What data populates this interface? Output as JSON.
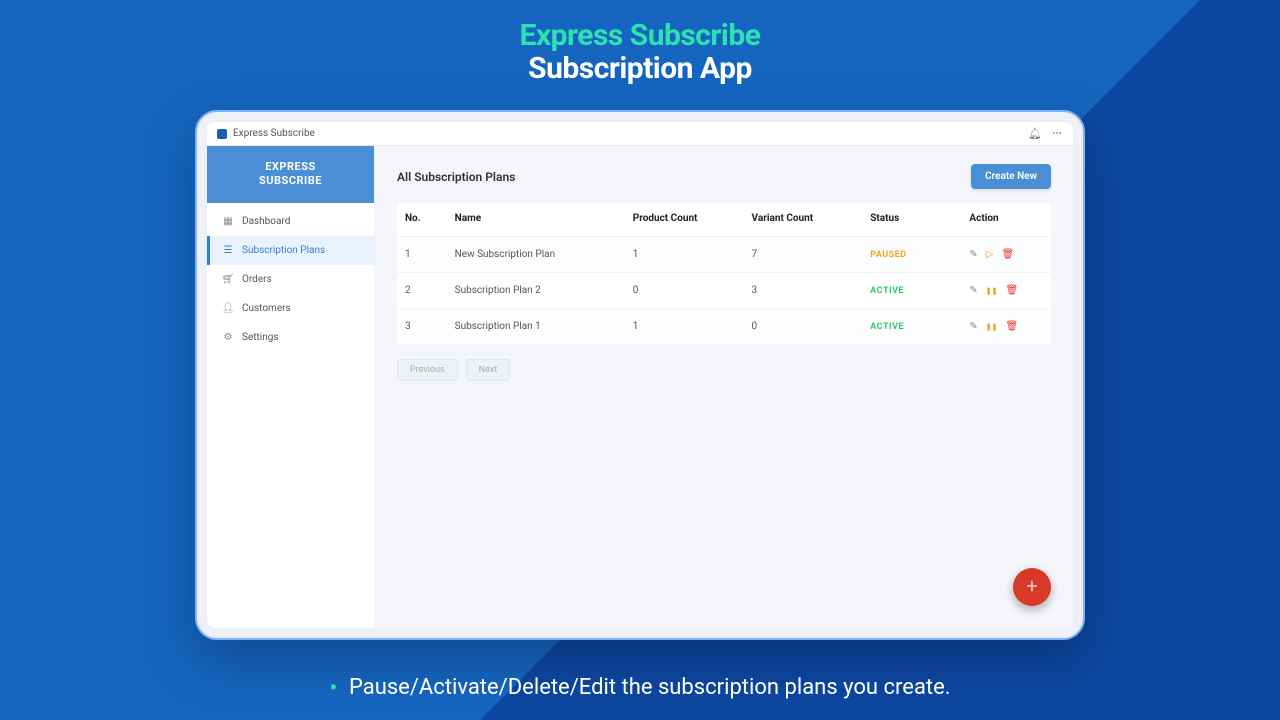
{
  "hero": {
    "title": "Express Subscribe",
    "subtitle": "Subscription App"
  },
  "topbar": {
    "title": "Express Subscribe"
  },
  "brand": {
    "line1": "EXPRESS",
    "line2": "SUBSCRIBE"
  },
  "nav": {
    "dashboard": "Dashboard",
    "subscription_plans": "Subscription Plans",
    "orders": "Orders",
    "customers": "Customers",
    "settings": "Settings"
  },
  "main": {
    "title": "All Subscription Plans",
    "create_label": "Create New"
  },
  "columns": {
    "no": "No.",
    "name": "Name",
    "product_count": "Product Count",
    "variant_count": "Variant Count",
    "status": "Status",
    "action": "Action"
  },
  "rows": [
    {
      "no": "1",
      "name": "New Subscription Plan",
      "product_count": "1",
      "variant_count": "7",
      "status": "PAUSED"
    },
    {
      "no": "2",
      "name": "Subscription Plan 2",
      "product_count": "0",
      "variant_count": "3",
      "status": "ACTIVE"
    },
    {
      "no": "3",
      "name": "Subscription Plan 1",
      "product_count": "1",
      "variant_count": "0",
      "status": "ACTIVE"
    }
  ],
  "pager": {
    "prev": "Previous",
    "next": "Next"
  },
  "caption": "Pause/Activate/Delete/Edit the subscription plans you create."
}
